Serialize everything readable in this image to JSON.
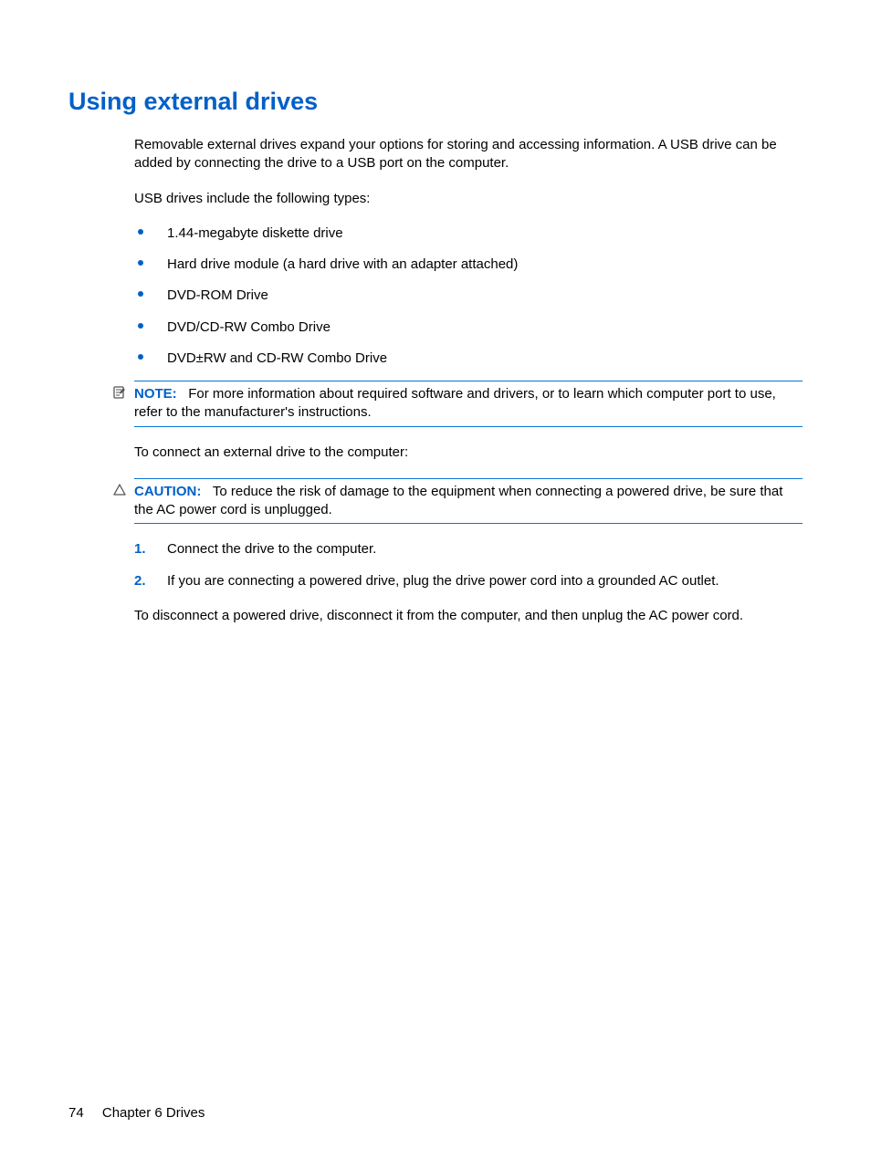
{
  "heading": "Using external drives",
  "intro": "Removable external drives expand your options for storing and accessing information. A USB drive can be added by connecting the drive to a USB port on the computer.",
  "usb_types_lead": "USB drives include the following types:",
  "usb_types": [
    "1.44-megabyte diskette drive",
    "Hard drive module (a hard drive with an adapter attached)",
    "DVD-ROM Drive",
    "DVD/CD-RW Combo Drive",
    "DVD±RW and CD-RW Combo Drive"
  ],
  "note": {
    "label": "NOTE:",
    "text": "For more information about required software and drivers, or to learn which computer port to use, refer to the manufacturer's instructions."
  },
  "connect_lead": "To connect an external drive to the computer:",
  "caution": {
    "label": "CAUTION:",
    "text": "To reduce the risk of damage to the equipment when connecting a powered drive, be sure that the AC power cord is unplugged."
  },
  "steps": [
    {
      "num": "1.",
      "text": "Connect the drive to the computer."
    },
    {
      "num": "2.",
      "text": "If you are connecting a powered drive, plug the drive power cord into a grounded AC outlet."
    }
  ],
  "disconnect": "To disconnect a powered drive, disconnect it from the computer, and then unplug the AC power cord.",
  "footer": {
    "page": "74",
    "chapter": "Chapter 6   Drives"
  }
}
